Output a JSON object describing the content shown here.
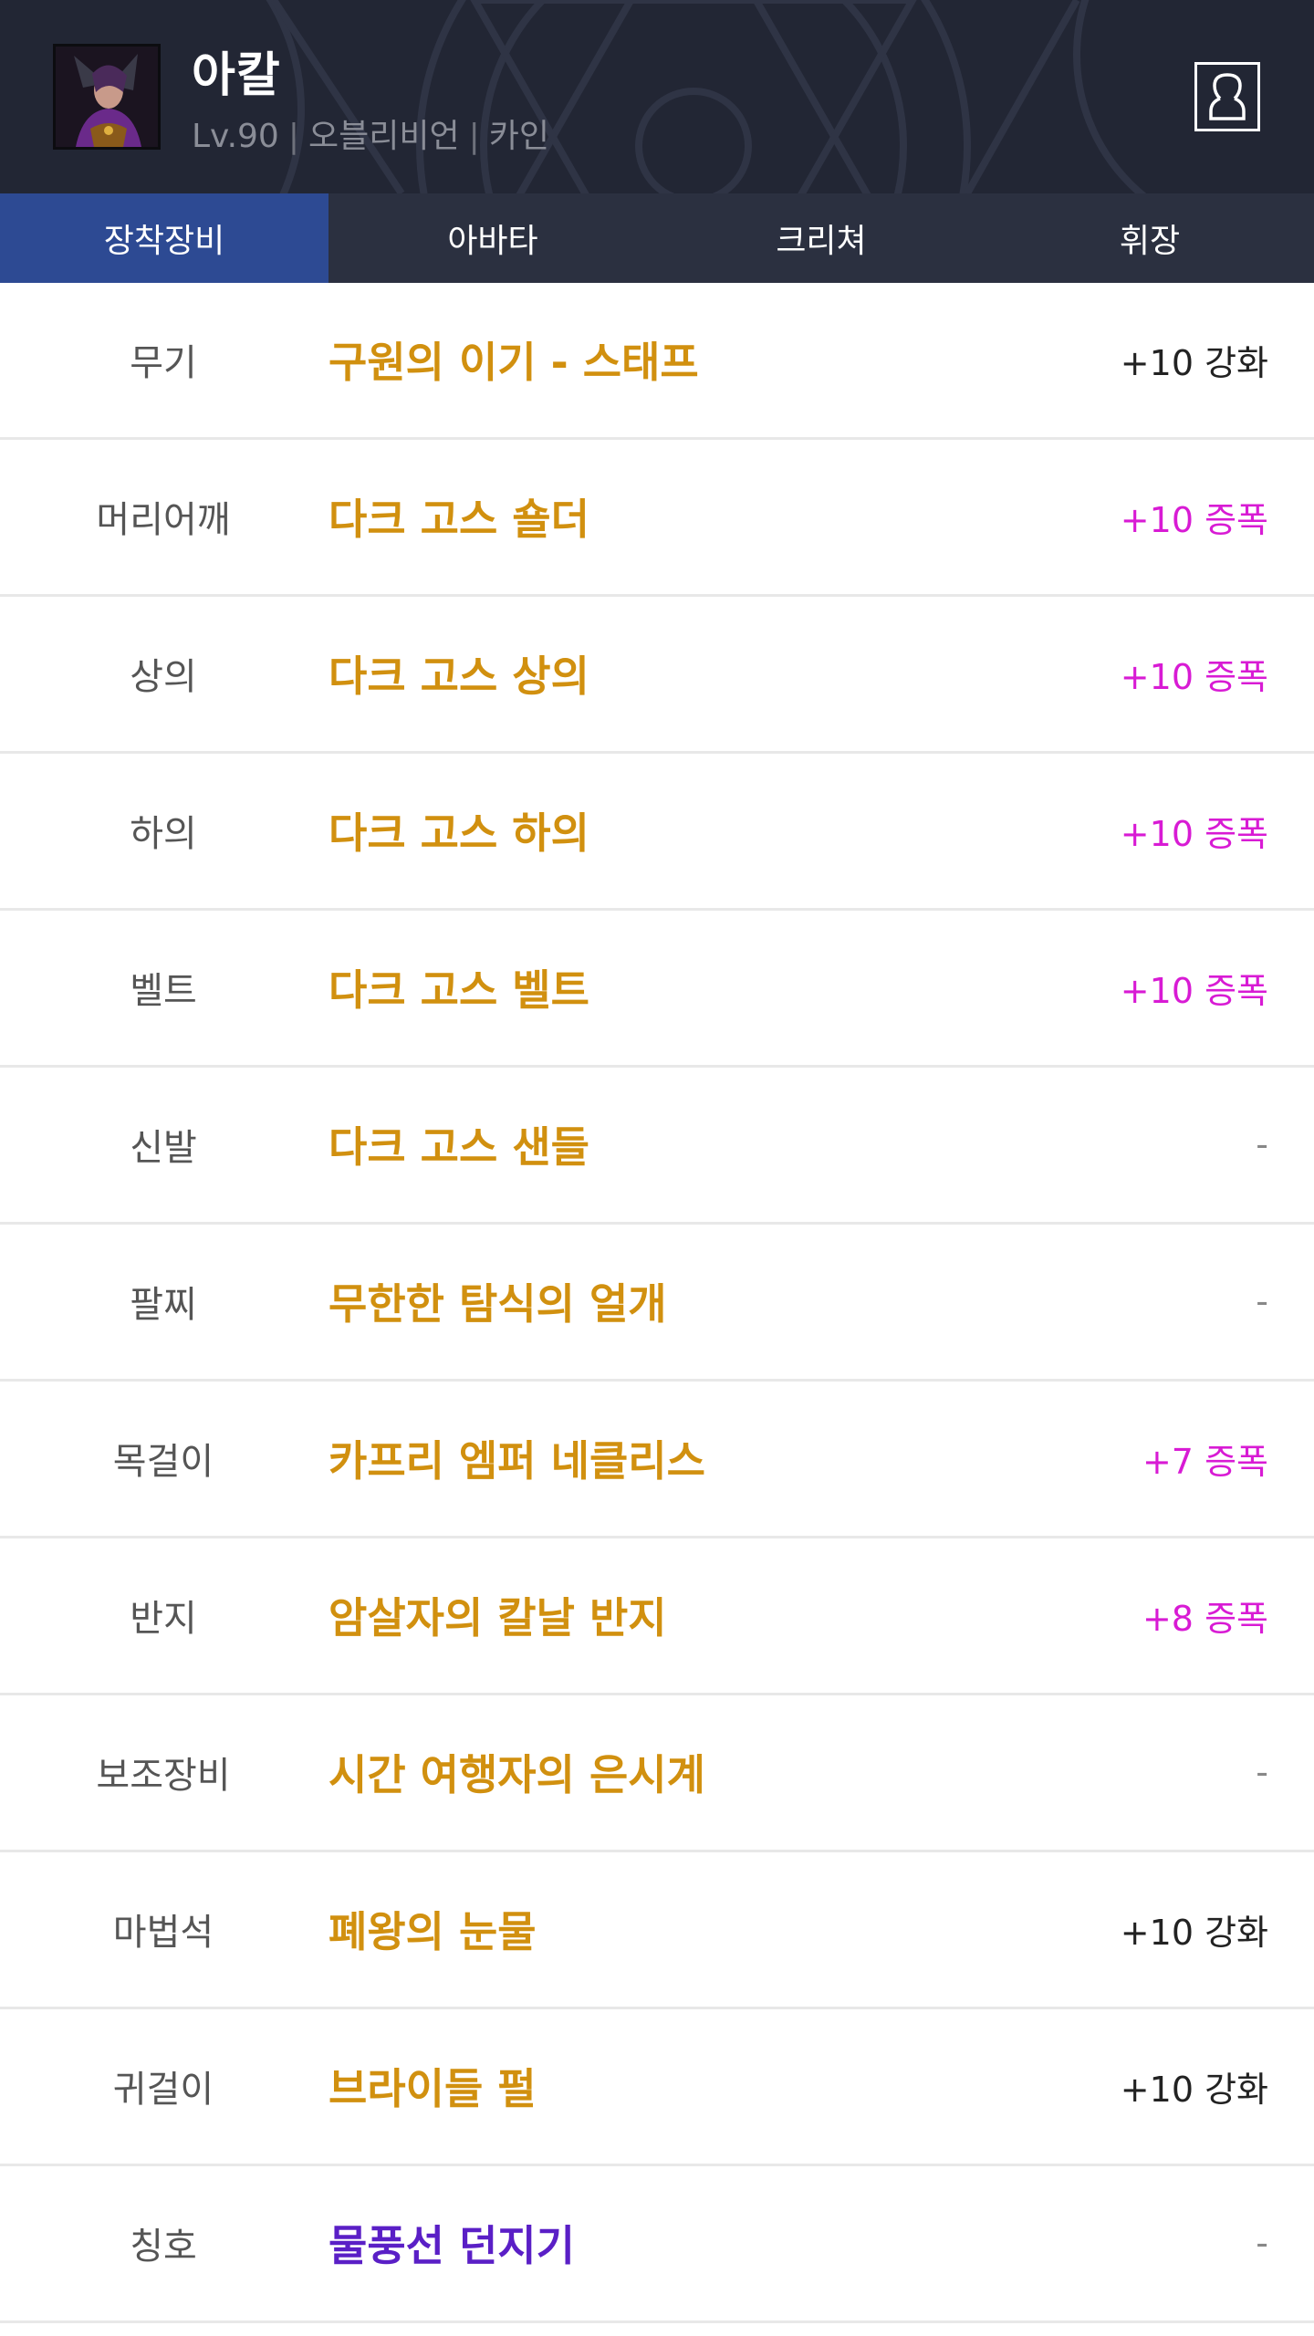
{
  "character": {
    "name": "아칼",
    "level": "Lv.90",
    "job": "오블리비언",
    "server": "카인"
  },
  "colors": {
    "header_bg": "#222634",
    "tab_bg": "#2b3040",
    "tab_active": "#2d4a93",
    "item_unique": "#d1900f",
    "item_epic": "#5a1fc6",
    "amplify": "#d81bd4",
    "reinforce": "#222222"
  },
  "tabs": [
    {
      "label": "장착장비",
      "active": true
    },
    {
      "label": "아바타",
      "active": false
    },
    {
      "label": "크리쳐",
      "active": false
    },
    {
      "label": "휘장",
      "active": false
    }
  ],
  "equipment": [
    {
      "slot": "무기",
      "item": "구원의 이기 - 스태프",
      "enhance": "+10 강화",
      "type": "reinforce",
      "rarity": "unique"
    },
    {
      "slot": "머리어깨",
      "item": "다크 고스 숄더",
      "enhance": "+10 증폭",
      "type": "amplify",
      "rarity": "unique"
    },
    {
      "slot": "상의",
      "item": "다크 고스 상의",
      "enhance": "+10 증폭",
      "type": "amplify",
      "rarity": "unique"
    },
    {
      "slot": "하의",
      "item": "다크 고스 하의",
      "enhance": "+10 증폭",
      "type": "amplify",
      "rarity": "unique"
    },
    {
      "slot": "벨트",
      "item": "다크 고스 벨트",
      "enhance": "+10 증폭",
      "type": "amplify",
      "rarity": "unique"
    },
    {
      "slot": "신발",
      "item": "다크 고스 샌들",
      "enhance": "-",
      "type": "none",
      "rarity": "unique"
    },
    {
      "slot": "팔찌",
      "item": "무한한 탐식의 얼개",
      "enhance": "-",
      "type": "none",
      "rarity": "unique"
    },
    {
      "slot": "목걸이",
      "item": "카프리 엠퍼 네클리스",
      "enhance": "+7 증폭",
      "type": "amplify",
      "rarity": "unique"
    },
    {
      "slot": "반지",
      "item": "암살자의 칼날 반지",
      "enhance": "+8 증폭",
      "type": "amplify",
      "rarity": "unique"
    },
    {
      "slot": "보조장비",
      "item": "시간 여행자의 은시계",
      "enhance": "-",
      "type": "none",
      "rarity": "unique"
    },
    {
      "slot": "마법석",
      "item": "폐왕의 눈물",
      "enhance": "+10 강화",
      "type": "reinforce",
      "rarity": "unique"
    },
    {
      "slot": "귀걸이",
      "item": "브라이들 펄",
      "enhance": "+10 강화",
      "type": "reinforce",
      "rarity": "unique"
    },
    {
      "slot": "칭호",
      "item": "물풍선 던지기",
      "enhance": "-",
      "type": "none",
      "rarity": "epic"
    }
  ]
}
